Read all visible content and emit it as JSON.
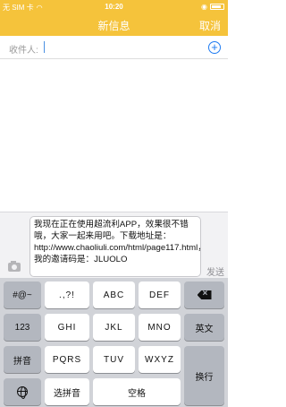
{
  "status_bar": {
    "carrier": "无 SIM 卡",
    "time": "10:20"
  },
  "nav": {
    "title": "新信息",
    "cancel": "取消"
  },
  "recipient": {
    "label": "收件人:",
    "add_icon": "plus-circle-icon"
  },
  "compose": {
    "message": "我现在正在使用超流利APP，效果很不错哦，大家一起来用吧。下载地址是：http://www.chaoliuli.com/html/page117.html，我的邀请码是：JLUOLO",
    "send": "发送",
    "camera_icon": "camera-icon"
  },
  "keyboard": {
    "row1": [
      "#@~",
      ".,?!",
      "ABC",
      "DEF"
    ],
    "row2": [
      "123",
      "GHI",
      "JKL",
      "MNO",
      "英文"
    ],
    "row3": [
      "拼音",
      "PQRS",
      "TUV",
      "WXYZ",
      "换行"
    ],
    "row4": [
      "选拼音",
      "空格"
    ],
    "backspace_icon": "backspace-icon",
    "globe_icon": "globe-icon"
  },
  "colors": {
    "accent": "#f5c33b",
    "link": "#1e7bf2"
  }
}
